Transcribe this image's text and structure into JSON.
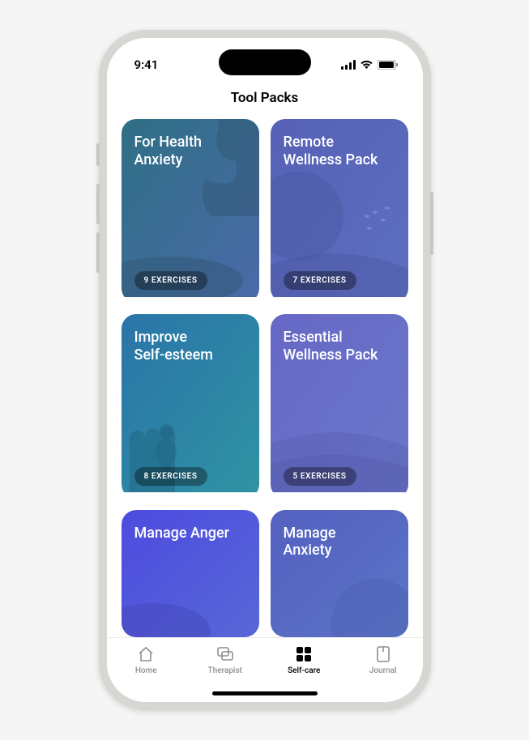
{
  "status": {
    "time": "9:41"
  },
  "page": {
    "title": "Tool Packs"
  },
  "cards": [
    {
      "title": "For Health\nAnxiety",
      "badge": "9 EXERCISES"
    },
    {
      "title": "Remote\nWellness Pack",
      "badge": "7 EXERCISES"
    },
    {
      "title": "Improve\nSelf-esteem",
      "badge": "8 EXERCISES"
    },
    {
      "title": "Essential\nWellness Pack",
      "badge": "5 EXERCISES"
    },
    {
      "title": "Manage Anger",
      "badge": ""
    },
    {
      "title": "Manage\nAnxiety",
      "badge": ""
    }
  ],
  "tabs": [
    {
      "label": "Home"
    },
    {
      "label": "Therapist"
    },
    {
      "label": "Self-care"
    },
    {
      "label": "Journal"
    }
  ]
}
